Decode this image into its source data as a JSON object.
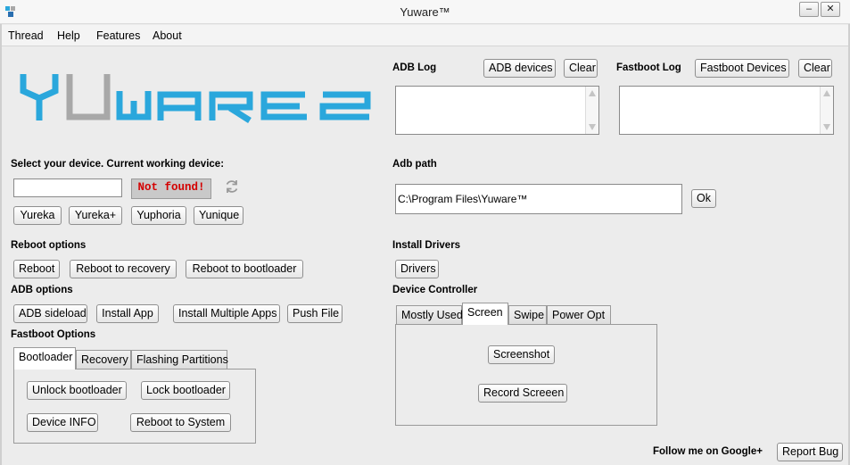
{
  "window": {
    "title": "Yuware™",
    "minimize_glyph": "–",
    "close_glyph": "✕"
  },
  "menu": [
    "Thread",
    "Help",
    "Features",
    "About"
  ],
  "logo": {
    "text_left": "YU",
    "text_right": "WARE",
    "color_blue": "#2aa7dc",
    "color_grey": "#a8a8a8"
  },
  "device": {
    "label": "Select your device. Current working device:",
    "input_value": "",
    "status": "Not found!",
    "models": [
      "Yureka",
      "Yureka+",
      "Yuphoria",
      "Yunique"
    ]
  },
  "reboot": {
    "label": "Reboot options",
    "buttons": [
      "Reboot",
      "Reboot to recovery",
      "Reboot to bootloader"
    ]
  },
  "adb_options": {
    "label": "ADB options",
    "buttons": [
      "ADB sideload",
      "Install App",
      "Install Multiple Apps",
      "Push File"
    ]
  },
  "fastboot": {
    "label": "Fastboot Options",
    "tabs": [
      "Bootloader",
      "Recovery",
      "Flashing Partitions"
    ],
    "active_tab": 0,
    "buttons": [
      "Unlock bootloader",
      "Lock bootloader",
      "Device INFO",
      "Reboot to System"
    ]
  },
  "adb_log": {
    "label": "ADB Log",
    "devices_btn": "ADB devices",
    "clear_btn": "Clear"
  },
  "fastboot_log": {
    "label": "Fastboot Log",
    "devices_btn": "Fastboot Devices",
    "clear_btn": "Clear"
  },
  "adb_path": {
    "label": "Adb path",
    "value": "C:\\Program Files\\Yuware™",
    "ok_btn": "Ok"
  },
  "drivers": {
    "label": "Install Drivers",
    "button": "Drivers"
  },
  "device_controller": {
    "label": "Device Controller",
    "tabs": [
      "Mostly Used",
      "Screen",
      "Swipe",
      "Power Opt"
    ],
    "active_tab": 1,
    "buttons": [
      "Screenshot",
      "Record Screeen"
    ]
  },
  "footer": {
    "follow_text": "Follow me on Google+",
    "report_btn": "Report Bug"
  }
}
